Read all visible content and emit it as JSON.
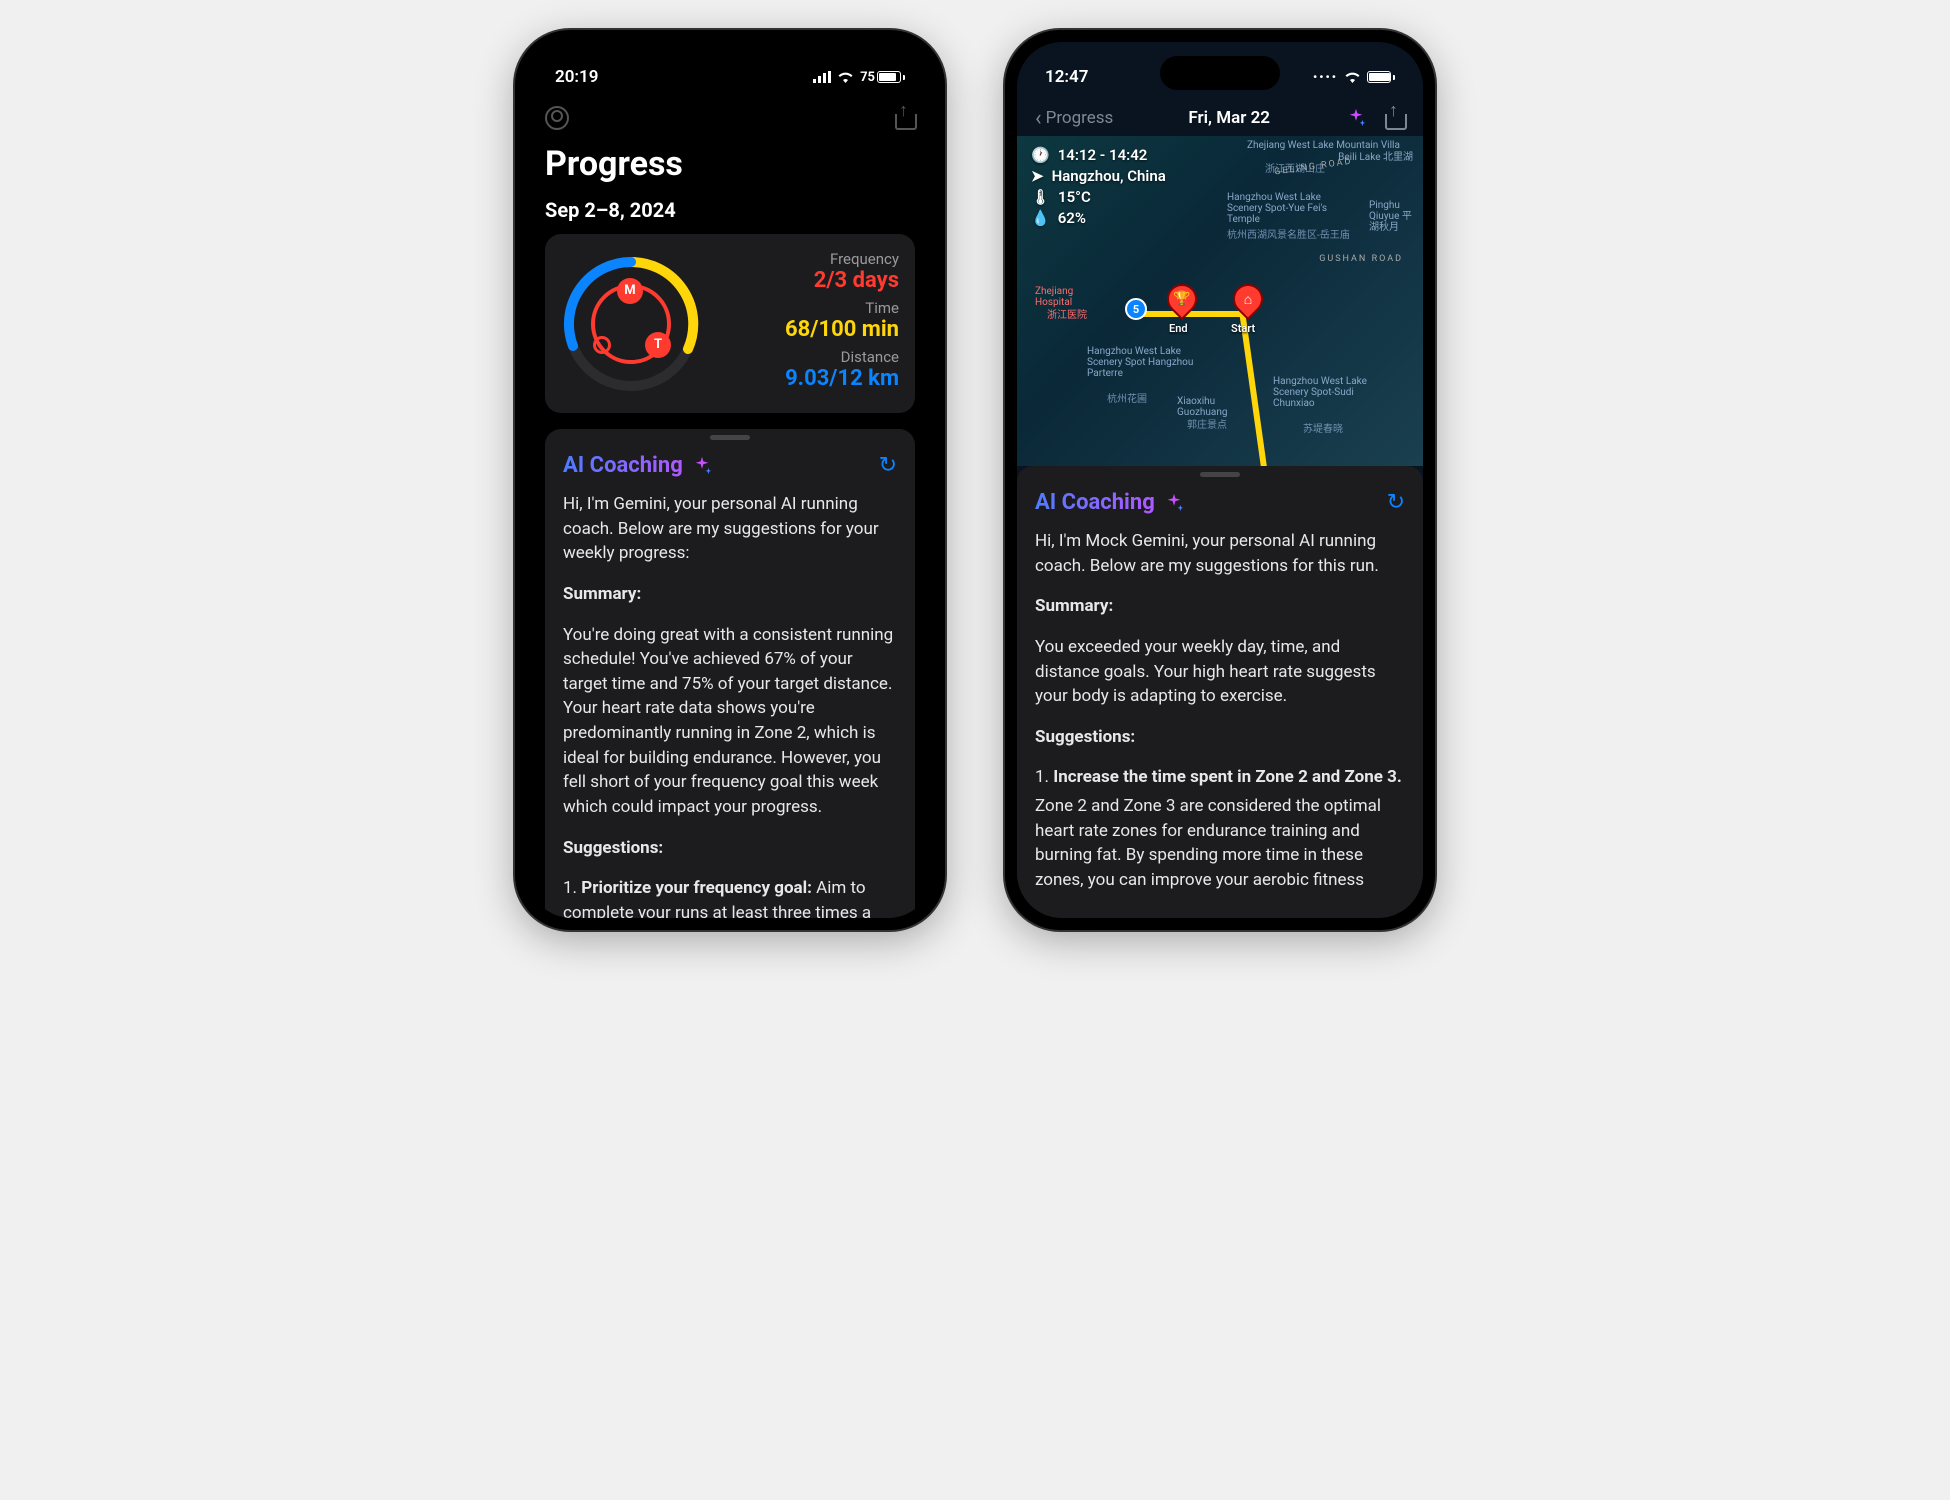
{
  "left": {
    "status": {
      "time": "20:19",
      "battery_pct": 75
    },
    "header": {
      "title": "Progress",
      "date_range": "Sep 2–8, 2024"
    },
    "stats": {
      "frequency_label": "Frequency",
      "frequency_value": "2/3 days",
      "time_label": "Time",
      "time_value": "68/100 min",
      "distance_label": "Distance",
      "distance_value": "9.03/12 km",
      "ring_markers": [
        "M",
        "T"
      ]
    },
    "coaching": {
      "title": "AI Coaching",
      "intro": "Hi, I'm Gemini, your personal AI running coach. Below are my suggestions for your weekly progress:",
      "summary_h": "Summary:",
      "summary": "You're doing great with a consistent running schedule! You've achieved 67% of your target time and 75% of your target distance. Your heart rate data shows you're predominantly running in Zone 2, which is ideal for building endurance. However, you fell short of your frequency goal this week which could impact your progress.",
      "suggestions_h": "Suggestions:",
      "s1_bold": "Prioritize your frequency goal:",
      "s1_rest": " Aim to complete your runs at least three times a week."
    }
  },
  "right": {
    "status": {
      "time": "12:47"
    },
    "nav": {
      "back": "Progress",
      "title": "Fri, Mar 22"
    },
    "map": {
      "time_range": "14:12 - 14:42",
      "location": "Hangzhou, China",
      "temp": "15°C",
      "humidity": "62%",
      "start_label": "Start",
      "end_label": "End",
      "waypoint": "5",
      "pois": [
        "Zhejiang West Lake Mountain Villa",
        "浙江西湖山庄",
        "Beili Lake 北里湖",
        "Hangzhou West Lake Scenery Spot-Yue Fei's Temple",
        "杭州西湖风景名胜区-岳王庙",
        "Pinghu Qiuyue 平湖秋月",
        "GUSHAN ROAD",
        "GELING ROAD",
        "Zhejiang Hospital",
        "浙江医院",
        "Hangzhou West Lake Scenery Spot Hangzhou Parterre",
        "杭州花圃",
        "Xiaoxihu Guozhuang",
        "郭庄景点",
        "Hangzhou West Lake Scenery Spot-Sudi Chunxiao",
        "苏堤春晓"
      ]
    },
    "coaching": {
      "title": "AI Coaching",
      "intro": "Hi, I'm Mock Gemini, your personal AI running coach. Below are my suggestions for this run.",
      "summary_h": "Summary:",
      "summary": "You exceeded your weekly day, time, and distance goals. Your high heart rate suggests your body is adapting to exercise.",
      "suggestions_h": "Suggestions:",
      "s1_bold": "Increase the time spent in Zone 2 and Zone 3.",
      "s1_rest": "Zone 2 and Zone 3 are considered the optimal heart rate zones for endurance training and burning fat. By spending more time in these zones, you can improve your aerobic fitness"
    }
  },
  "colors": {
    "red": "#ff3b30",
    "yellow": "#ffd60a",
    "blue": "#0a84ff"
  }
}
